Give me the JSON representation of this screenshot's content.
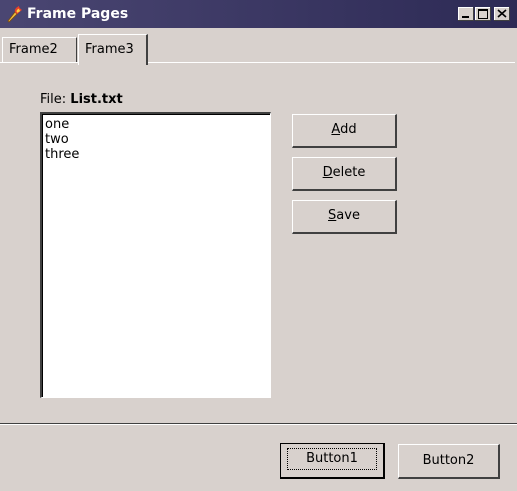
{
  "window": {
    "title": "Frame Pages"
  },
  "tabs": [
    {
      "label": "Frame2",
      "active": false
    },
    {
      "label": "Frame3",
      "active": true
    }
  ],
  "file": {
    "label": "File:",
    "name": "List.txt"
  },
  "list": {
    "items": [
      "one",
      "two",
      "three"
    ]
  },
  "actions": {
    "add": {
      "underline": "A",
      "rest": "dd"
    },
    "delete": {
      "underline": "D",
      "rest": "elete"
    },
    "save": {
      "underline": "S",
      "rest": "ave"
    }
  },
  "footer": {
    "button1": "Button1",
    "button2": "Button2"
  },
  "colors": {
    "titlebar": "#2d2a55",
    "face": "#d8d1cd"
  },
  "icons": {
    "app": "torch-icon",
    "minimize": "minimize-icon",
    "maximize": "maximize-icon",
    "close": "close-icon"
  }
}
